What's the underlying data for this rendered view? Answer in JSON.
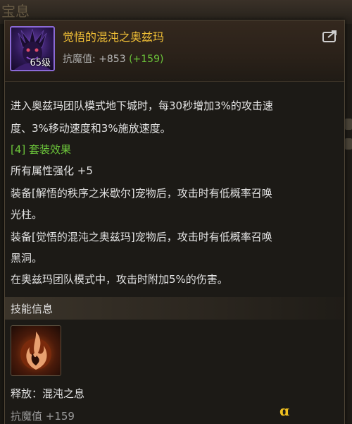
{
  "background": {
    "title": "宝息"
  },
  "item": {
    "name": "觉悟的混沌之奥兹玛",
    "level_badge": "65级",
    "stat_label": "抗魔值:",
    "stat_value": "+853",
    "stat_bonus": "(+159)",
    "rarity_color": "#8b6ad6",
    "name_color": "#f0bf36"
  },
  "description": {
    "line1": "进入奥兹玛团队模式地下城时，每30秒增加3%的攻击速",
    "line2": "度、3%移动速度和3%施放速度。",
    "set_header": "[4] 套装效果",
    "line3": "所有属性强化 +5",
    "line4": "装备[解悟的秩序之米歇尔]宠物后，攻击时有低概率召唤",
    "line5": "光柱。",
    "line6": "装备[觉悟的混沌之奥兹玛]宠物后，攻击时有低概率召唤",
    "line7": "黑洞。",
    "line8": "在奥兹玛团队模式中，攻击时附加5%的伤害。"
  },
  "skill": {
    "section_title": "技能信息",
    "name": "释放：混沌之息",
    "stat": "抗魔值 +159"
  },
  "icons": [
    "share-icon",
    "pet-avatar-icon",
    "skill-icon"
  ],
  "colors": {
    "green": "#6cc63a",
    "gold": "#f0bf36",
    "text": "#e4e4e4"
  }
}
